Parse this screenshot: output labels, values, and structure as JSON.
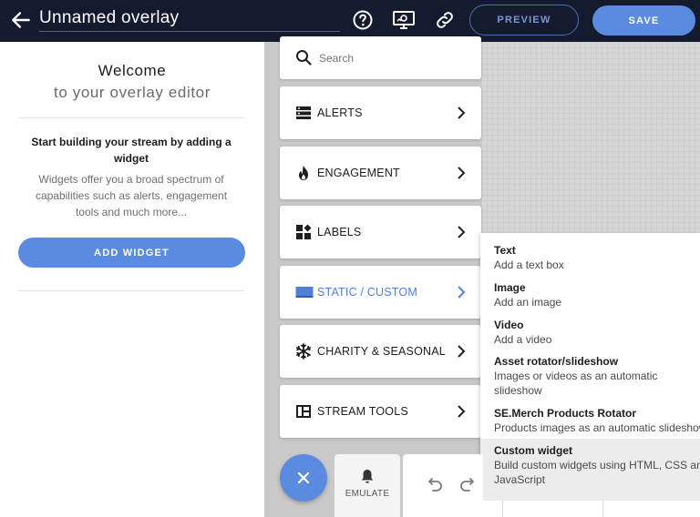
{
  "header": {
    "title": "Unnamed overlay",
    "preview_label": "PREVIEW",
    "save_label": "SAVE"
  },
  "left_panel": {
    "welcome_title": "Welcome",
    "welcome_subtitle": "to your overlay editor",
    "start_text": "Start building your stream by adding a widget",
    "description": "Widgets offer you a broad spectrum of capabilities such as alerts, engagement tools and much more...",
    "add_widget_label": "ADD WIDGET"
  },
  "widget_menu": {
    "search_placeholder": "Search",
    "categories": [
      {
        "label": "ALERTS",
        "icon": "alerts-icon"
      },
      {
        "label": "ENGAGEMENT",
        "icon": "flame-icon"
      },
      {
        "label": "LABELS",
        "icon": "labels-icon"
      },
      {
        "label": "STATIC / CUSTOM",
        "icon": "static-custom-icon",
        "active": true
      },
      {
        "label": "CHARITY & SEASONAL",
        "icon": "snowflake-icon"
      },
      {
        "label": "STREAM TOOLS",
        "icon": "stream-tools-icon"
      }
    ]
  },
  "submenu": {
    "items": [
      {
        "title": "Text",
        "description": "Add a text box"
      },
      {
        "title": "Image",
        "description": "Add an image"
      },
      {
        "title": "Video",
        "description": "Add a video"
      },
      {
        "title": "Asset rotator/slideshow",
        "description_line1": "Images or videos as an automatic",
        "description_line2": "slideshow"
      },
      {
        "title": "SE.Merch Products Rotator",
        "description": "Products images as an automatic slideshow"
      },
      {
        "title": "Custom widget",
        "description_line1": "Build custom widgets using HTML, CSS and",
        "description_line2": "JavaScript"
      }
    ]
  },
  "toolbar": {
    "emulate_label": "EMULATE"
  },
  "colors": {
    "topbar_bg": "#151b2e",
    "accent": "#5b8be0",
    "active_category": "#4f7fd6"
  }
}
